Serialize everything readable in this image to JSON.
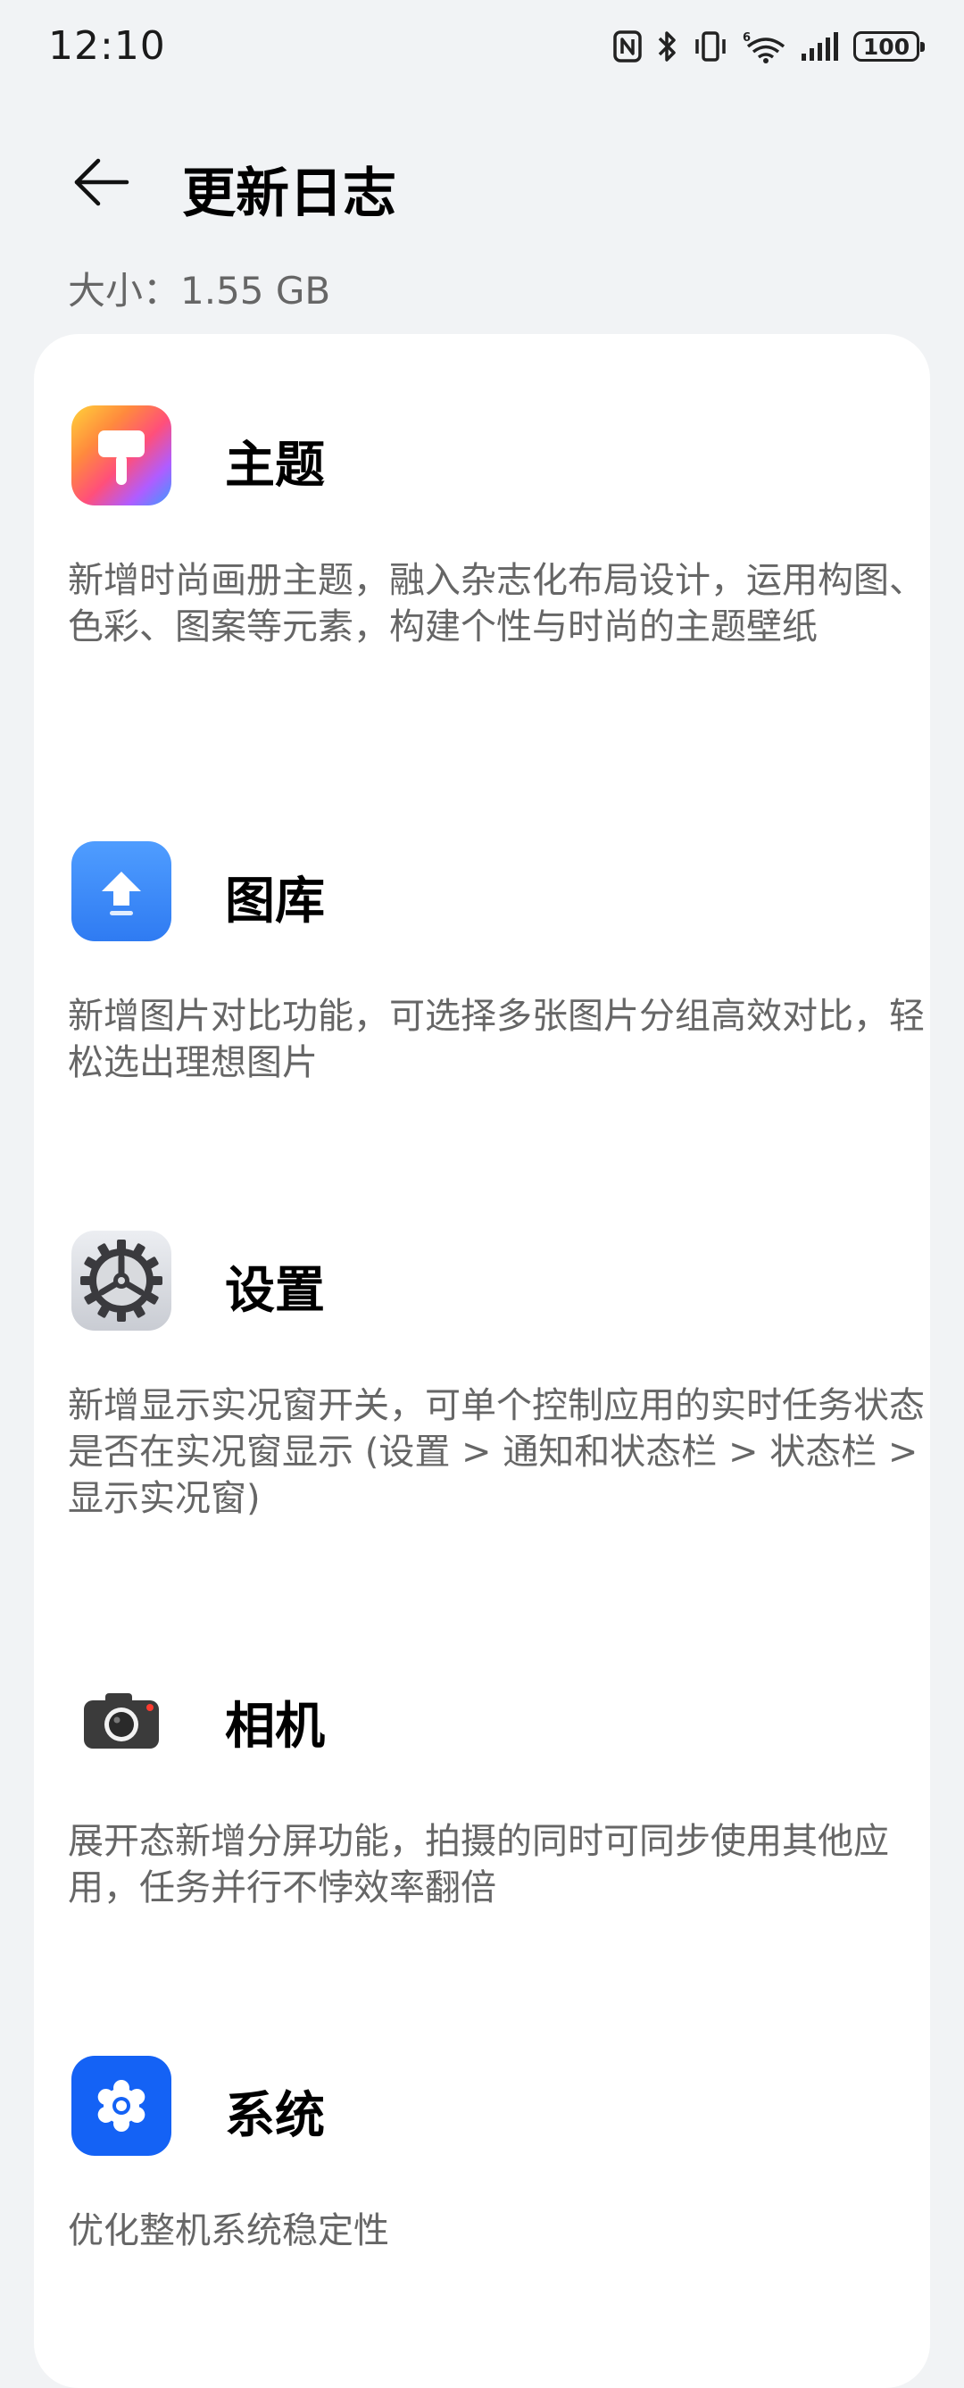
{
  "status_bar": {
    "time": "12:10",
    "battery": "100",
    "icons": [
      "nfc-icon",
      "bluetooth-icon",
      "vibrate-icon",
      "wifi-icon",
      "signal-icon",
      "battery-icon"
    ]
  },
  "header": {
    "title": "更新日志",
    "back_icon": "back-arrow-icon"
  },
  "size": {
    "text": "大小：1.55 GB"
  },
  "entries": [
    {
      "name": "主题",
      "icon": "theme-brush-icon",
      "description": "新增时尚画册主题，融入杂志化布局设计，运用构图、色彩、图案等元素，构建个性与时尚的主题壁纸"
    },
    {
      "name": "图库",
      "icon": "gallery-icon",
      "description": "新增图片对比功能，可选择多张图片分组高效对比，轻松选出理想图片"
    },
    {
      "name": "设置",
      "icon": "settings-gear-icon",
      "description": "新增显示实况窗开关，可单个控制应用的实时任务状态是否在实况窗显示 (设置 > 通知和状态栏 > 状态栏 > 显示实况窗)"
    },
    {
      "name": "相机",
      "icon": "camera-icon",
      "description": "展开态新增分屏功能，拍摄的同时可同步使用其他应用，任务并行不悖效率翻倍"
    },
    {
      "name": "系统",
      "icon": "system-gear-icon",
      "description": "优化整机系统稳定性"
    }
  ]
}
